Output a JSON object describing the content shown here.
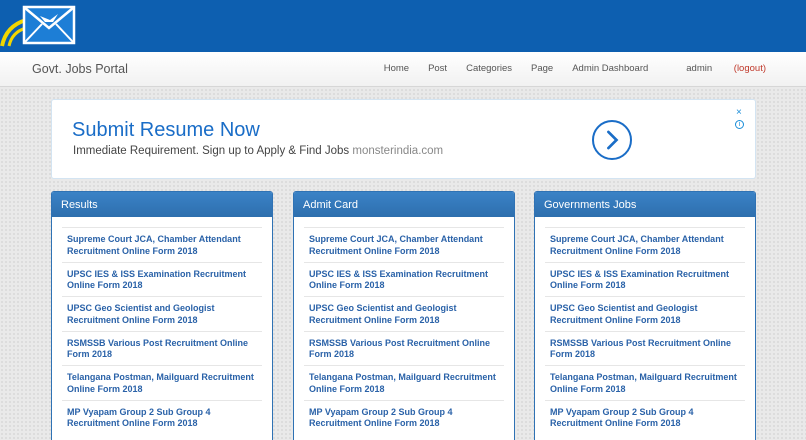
{
  "nav": {
    "brand": "Govt. Jobs Portal",
    "links": [
      "Home",
      "Post",
      "Categories",
      "Page",
      "Admin Dashboard"
    ],
    "user": "admin",
    "logout": "(logout)"
  },
  "ad": {
    "title": "Submit Resume Now",
    "subtitle": "Immediate Requirement. Sign up to Apply & Find Jobs",
    "domain": "monsterindia.com",
    "close": "×",
    "info": "i"
  },
  "panels": [
    {
      "title": "Results",
      "items": [
        "Supreme Court JCA, Chamber Attendant Recruitment Online Form 2018",
        "UPSC IES & ISS Examination Recruitment Online Form 2018",
        "UPSC Geo Scientist and Geologist Recruitment Online Form 2018",
        "RSMSSB Various Post Recruitment Online Form 2018",
        "Telangana Postman, Mailguard Recruitment Online Form 2018",
        "MP Vyapam Group 2 Sub Group 4 Recruitment Online Form 2018"
      ]
    },
    {
      "title": "Admit Card",
      "items": [
        "Supreme Court JCA, Chamber Attendant Recruitment Online Form 2018",
        "UPSC IES & ISS Examination Recruitment Online Form 2018",
        "UPSC Geo Scientist and Geologist Recruitment Online Form 2018",
        "RSMSSB Various Post Recruitment Online Form 2018",
        "Telangana Postman, Mailguard Recruitment Online Form 2018",
        "MP Vyapam Group 2 Sub Group 4 Recruitment Online Form 2018"
      ]
    },
    {
      "title": "Governments Jobs",
      "items": [
        "Supreme Court JCA, Chamber Attendant Recruitment Online Form 2018",
        "UPSC IES & ISS Examination Recruitment Online Form 2018",
        "UPSC Geo Scientist and Geologist Recruitment Online Form 2018",
        "RSMSSB Various Post Recruitment Online Form 2018",
        "Telangana Postman, Mailguard Recruitment Online Form 2018",
        "MP Vyapam Group 2 Sub Group 4 Recruitment Online Form 2018"
      ]
    }
  ],
  "colors": {
    "header_blue": "#0d5fb0",
    "panel_blue": "#2e6fae",
    "link_blue": "#2a62a8",
    "logout_red": "#c0392b"
  },
  "icons": {
    "logo": "envelope-bird-logo-icon",
    "ad_arrow": "chevron-right-icon",
    "ad_close": "close-icon",
    "ad_info": "info-icon"
  }
}
